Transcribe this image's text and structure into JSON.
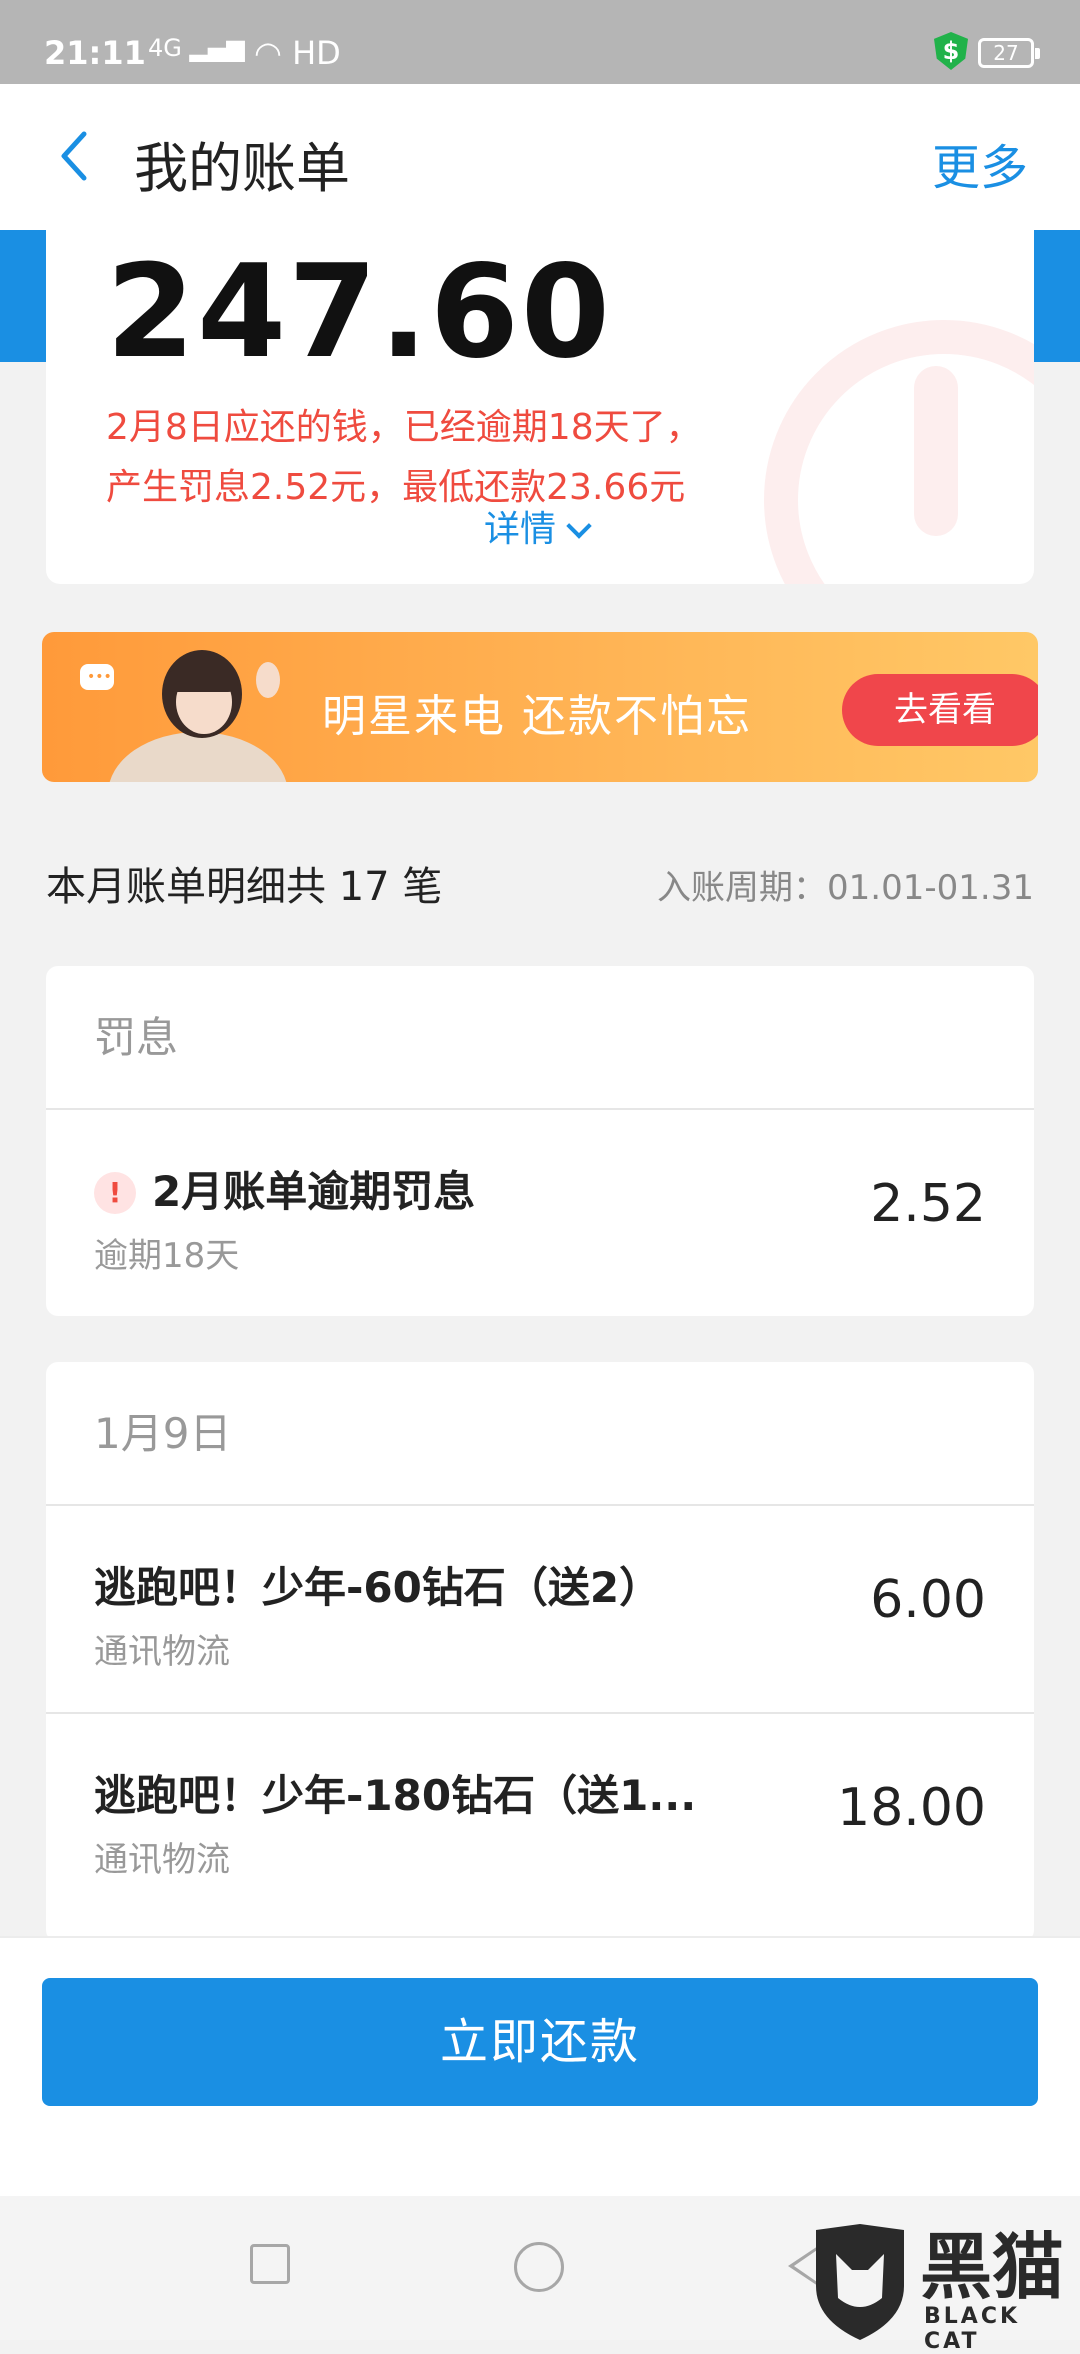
{
  "status_bar": {
    "time": "21:11",
    "network": "4G",
    "hd": "HD",
    "battery": "27"
  },
  "header": {
    "title": "我的账单",
    "more_label": "更多"
  },
  "bill": {
    "amount": "247.60",
    "warning_line1": "2月8日应还的钱，已经逾期18天了，",
    "warning_line2": "产生罚息2.52元，最低还款23.66元",
    "detail_label": "详情"
  },
  "banner": {
    "slogan": "明星来电 还款不怕忘",
    "cta_label": "去看看"
  },
  "summary": {
    "count_text": "本月账单明细共 17 笔",
    "period_text": "入账周期：01.01-01.31"
  },
  "penalty_group": {
    "header": "罚息",
    "items": [
      {
        "name": "2月账单逾期罚息",
        "sub": "逾期18天",
        "amount": "2.52"
      }
    ]
  },
  "jan_group": {
    "header": "1月9日",
    "items": [
      {
        "name": "逃跑吧！少年-60钻石（送2）",
        "sub": "通讯物流",
        "amount": "6.00"
      },
      {
        "name": "逃跑吧！少年-180钻石（送1...",
        "sub": "通讯物流",
        "amount": "18.00"
      }
    ]
  },
  "actions": {
    "pay_label": "立即还款"
  },
  "watermark": {
    "brand": "黑猫",
    "brand_sub": "BLACK CAT"
  },
  "colors": {
    "accent": "#1a8fe3",
    "warning": "#ef4b3f",
    "cta": "#f0464b"
  }
}
